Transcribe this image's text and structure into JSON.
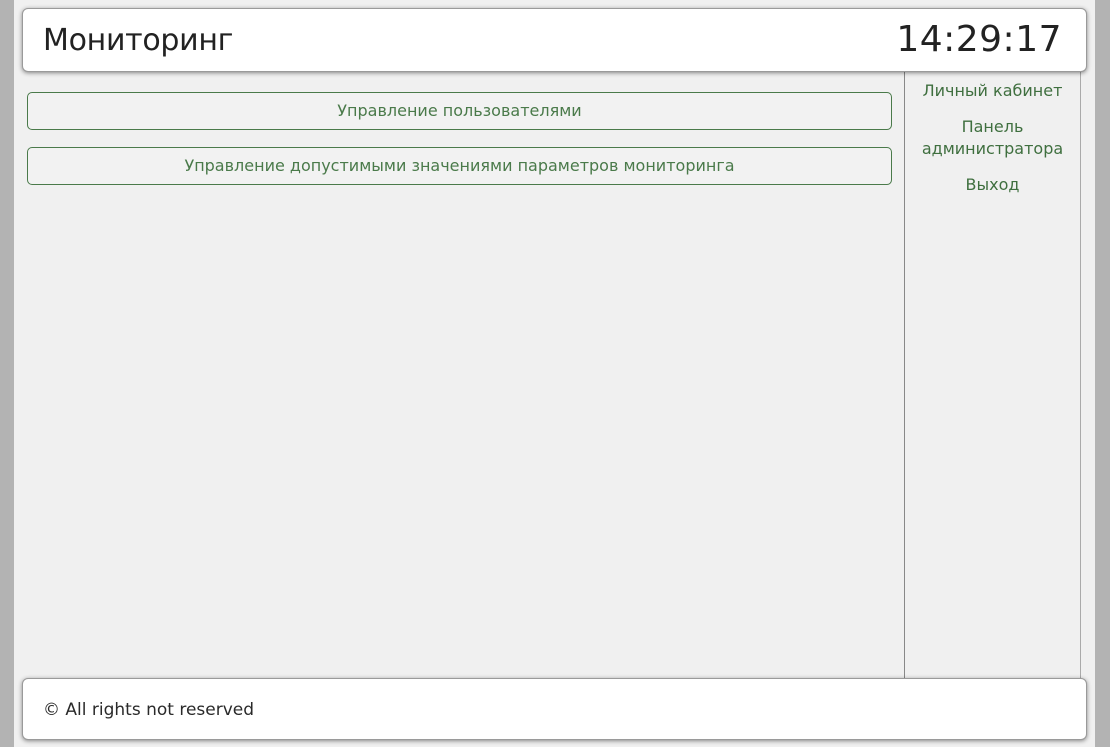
{
  "header": {
    "title": "Мониторинг",
    "clock": "14:29:17"
  },
  "main": {
    "buttons": [
      {
        "label": "Управление пользователями"
      },
      {
        "label": "Управление допустимыми значениями параметров мониторинга"
      }
    ]
  },
  "sidebar": {
    "items": [
      {
        "label": "Личный кабинет"
      },
      {
        "label_line1": "Панель",
        "label_line2": "администратора"
      },
      {
        "label": "Выход"
      }
    ]
  },
  "footer": {
    "text": "© All rights not reserved"
  },
  "colors": {
    "accent": "#4a7a4a",
    "background": "#f0f0f0",
    "outer": "#b3b3b3"
  }
}
